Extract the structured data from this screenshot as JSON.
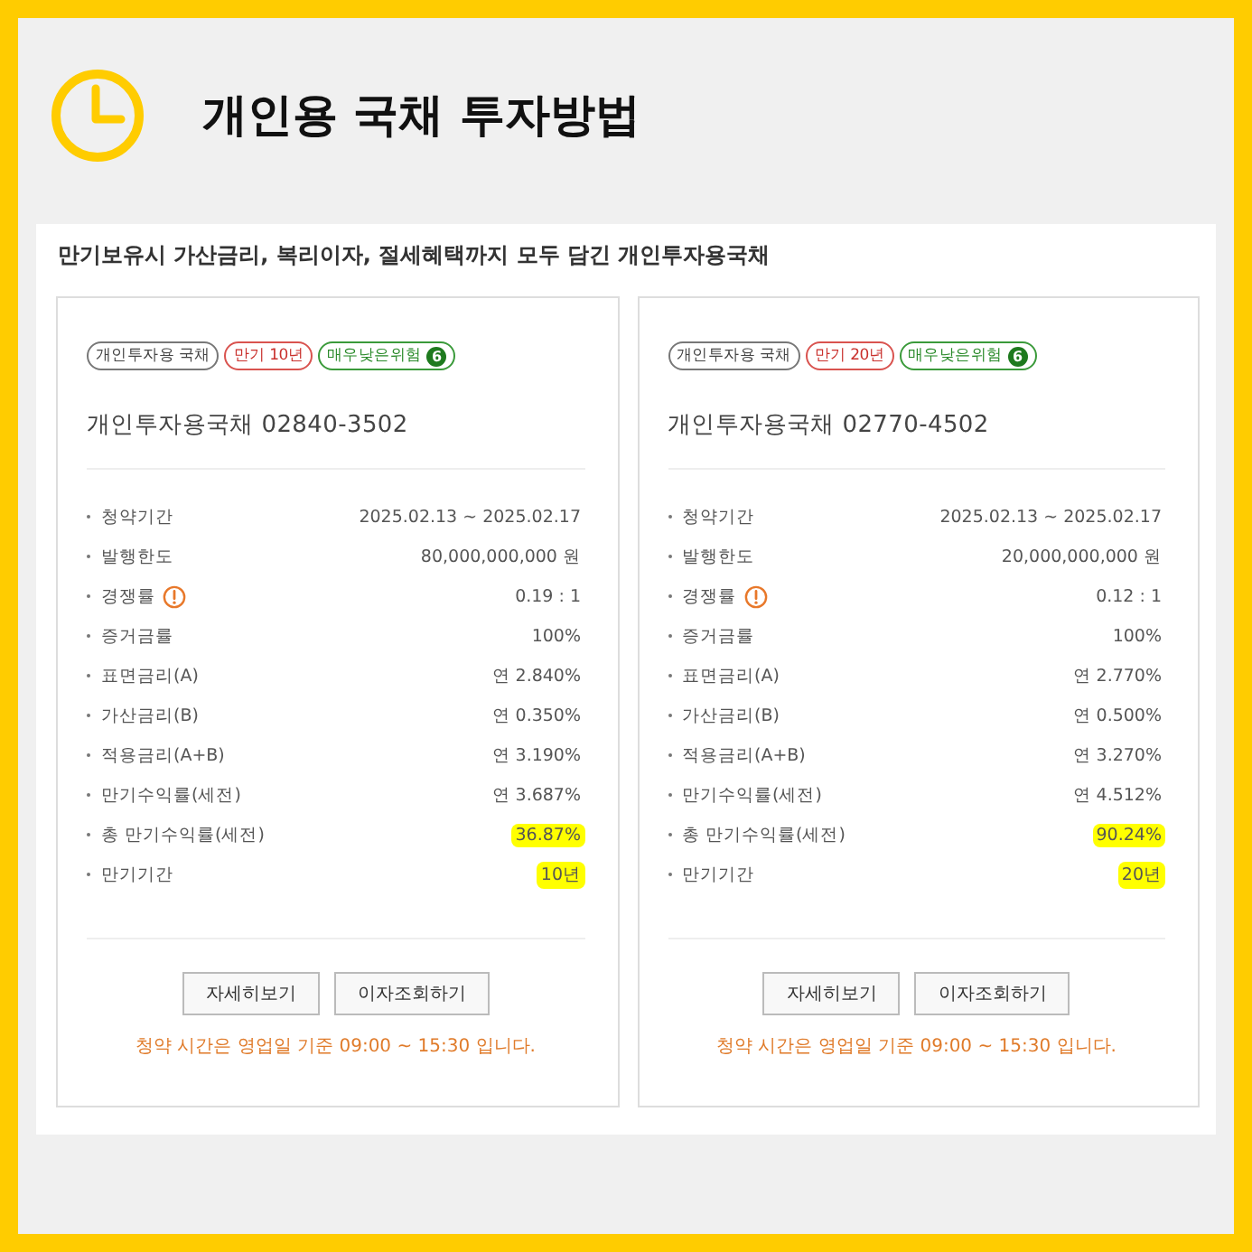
{
  "header": {
    "title": "개인용 국채 투자방법"
  },
  "panel": {
    "subtitle": "만기보유시 가산금리, 복리이자, 절세혜택까지 모두 담긴 개인투자용국채",
    "cards": [
      {
        "tags": [
          {
            "kind": "type",
            "label": "개인투자용 국채"
          },
          {
            "kind": "term",
            "label": "만기 10년"
          },
          {
            "kind": "risk",
            "label": "매우낮은위험",
            "grade": "6"
          }
        ],
        "name": "개인투자용국채 02840-3502",
        "rows": [
          {
            "label": "청약기간",
            "value": "2025.02.13 ~ 2025.02.17",
            "info": false,
            "highlighted": false
          },
          {
            "label": "발행한도",
            "value": "80,000,000,000 원",
            "info": false,
            "highlighted": false
          },
          {
            "label": "경쟁률",
            "value": "0.19 : 1",
            "info": true,
            "highlighted": false
          },
          {
            "label": "증거금률",
            "value": "100%",
            "info": false,
            "highlighted": false
          },
          {
            "label": "표면금리(A)",
            "value": "연 2.840%",
            "info": false,
            "highlighted": false
          },
          {
            "label": "가산금리(B)",
            "value": "연 0.350%",
            "info": false,
            "highlighted": false
          },
          {
            "label": "적용금리(A+B)",
            "value": "연 3.190%",
            "info": false,
            "highlighted": false
          },
          {
            "label": "만기수익률(세전)",
            "value": "연 3.687%",
            "info": false,
            "highlighted": false
          },
          {
            "label": "총 만기수익률(세전)",
            "value": "36.87%",
            "info": false,
            "highlighted": true
          },
          {
            "label": "만기기간",
            "value": "10년",
            "info": false,
            "highlighted": true
          }
        ],
        "buttons": [
          "자세히보기",
          "이자조회하기"
        ],
        "notice": "청약 시간은 영업일 기준 09:00 ~ 15:30 입니다."
      },
      {
        "tags": [
          {
            "kind": "type",
            "label": "개인투자용 국채"
          },
          {
            "kind": "term",
            "label": "만기 20년"
          },
          {
            "kind": "risk",
            "label": "매우낮은위험",
            "grade": "6"
          }
        ],
        "name": "개인투자용국채 02770-4502",
        "rows": [
          {
            "label": "청약기간",
            "value": "2025.02.13 ~ 2025.02.17",
            "info": false,
            "highlighted": false
          },
          {
            "label": "발행한도",
            "value": "20,000,000,000 원",
            "info": false,
            "highlighted": false
          },
          {
            "label": "경쟁률",
            "value": "0.12 : 1",
            "info": true,
            "highlighted": false
          },
          {
            "label": "증거금률",
            "value": "100%",
            "info": false,
            "highlighted": false
          },
          {
            "label": "표면금리(A)",
            "value": "연 2.770%",
            "info": false,
            "highlighted": false
          },
          {
            "label": "가산금리(B)",
            "value": "연 0.500%",
            "info": false,
            "highlighted": false
          },
          {
            "label": "적용금리(A+B)",
            "value": "연 3.270%",
            "info": false,
            "highlighted": false
          },
          {
            "label": "만기수익률(세전)",
            "value": "연 4.512%",
            "info": false,
            "highlighted": false
          },
          {
            "label": "총 만기수익률(세전)",
            "value": "90.24%",
            "info": false,
            "highlighted": true
          },
          {
            "label": "만기기간",
            "value": "20년",
            "info": false,
            "highlighted": true
          }
        ],
        "buttons": [
          "자세히보기",
          "이자조회하기"
        ],
        "notice": "청약 시간은 영업일 기준 09:00 ~ 15:30 입니다."
      }
    ]
  }
}
